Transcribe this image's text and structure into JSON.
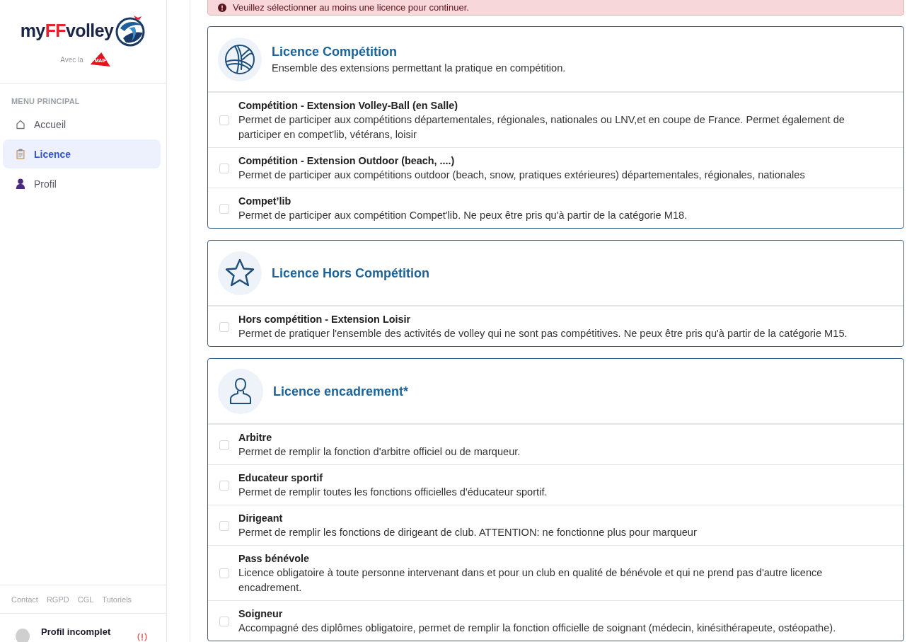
{
  "sidebar": {
    "logo": {
      "parts": [
        {
          "text": "my",
          "color": "#1b2547"
        },
        {
          "text": "FF",
          "color": "#e3232f"
        },
        {
          "text": "volley",
          "color": "#1b2547"
        }
      ],
      "partner_caption": "Avec la",
      "partner": "MAIF"
    },
    "menu": {
      "heading": "MENU PRINCIPAL",
      "items": [
        {
          "label": "Accueil",
          "selected": false
        },
        {
          "label": "Licence",
          "selected": true
        },
        {
          "label": "Profil",
          "selected": false
        }
      ]
    },
    "footer_links": [
      "Contact",
      "RGPD",
      "CGL",
      "Tutoriels"
    ],
    "user": {
      "name": "Profil incomplet"
    }
  },
  "alert": {
    "message": "Veuillez sélectionner au moins une licence pour continuer."
  },
  "cards": [
    {
      "title": "Licence Compétition",
      "description": "Ensemble des extensions permettant la pratique en compétition.",
      "options": [
        {
          "title": "Compétition - Extension Volley-Ball (en Salle)",
          "description": "Permet de participer aux compétitions départementales, régionales, nationales ou LNV,et en coupe de France. Permet également de participer en compet'lib, vétérans, loisir",
          "checked": false
        },
        {
          "title": "Compétition - Extension Outdoor (beach, ....)",
          "description": "Permet de participer aux compétitions outdoor (beach, snow, pratiques extérieures) départementales, régionales, nationales",
          "checked": false
        },
        {
          "title": "Compet’lib",
          "description": "Permet de participer aux compétition Compet'lib. Ne peux être pris qu'à partir de la catégorie M18.",
          "checked": false
        }
      ]
    },
    {
      "title": "Licence Hors Compétition",
      "options": [
        {
          "title": "Hors compétition - Extension Loisir",
          "description": "Permet de pratiquer l'ensemble des activités de volley qui ne sont pas compétitives. Ne peux être pris qu'à partir de la catégorie M15.",
          "checked": false
        }
      ]
    },
    {
      "title": "Licence encadrement*",
      "options": [
        {
          "title": "Arbitre",
          "description": "Permet de remplir la fonction d'arbitre officiel ou de marqueur.",
          "checked": false
        },
        {
          "title": "Educateur sportif",
          "description": "Permet de remplir toutes les fonctions officielles d'éducateur sportif.",
          "checked": false
        },
        {
          "title": "Dirigeant",
          "description": "Permet de remplir les fonctions de dirigeant de club. ATTENTION: ne fonctionne plus pour marqueur",
          "checked": false
        },
        {
          "title": "Pass bénévole",
          "description": "Licence obligatoire à toute personne intervenant dans et pour un club en qualité de bénévole et qui ne prend pas d'autre licence encadrement.",
          "checked": false
        },
        {
          "title": "Soigneur",
          "description": "Accompagné des diplômes obligatoire, permet de remplir la fonction officielle de soignant (médecin, kinésithérapeute, ostéopathe).",
          "checked": false
        }
      ]
    }
  ]
}
